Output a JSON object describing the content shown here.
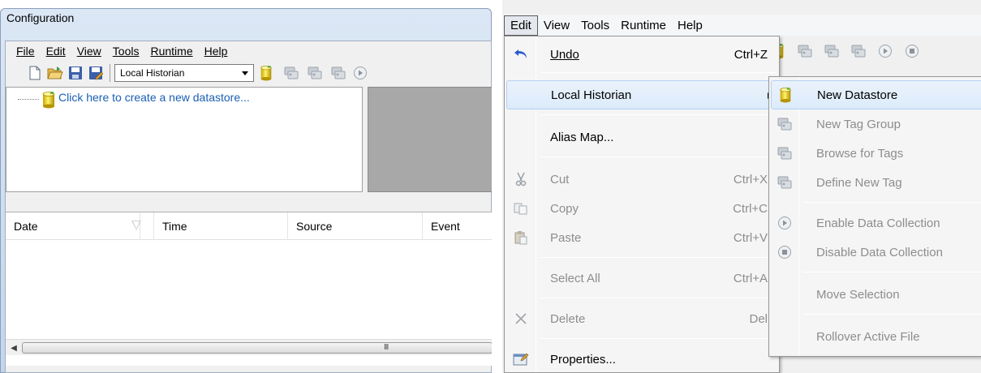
{
  "left_window": {
    "title": "Configuration",
    "menu": [
      "File",
      "Edit",
      "View",
      "Tools",
      "Runtime",
      "Help"
    ],
    "toolbar": {
      "datastore_select": "Local Historian",
      "icons": [
        "new-icon",
        "open-folder-icon",
        "save-icon",
        "save-as-icon",
        "datastore-icon",
        "tag-group-icon",
        "browse-tags-icon",
        "define-tag-icon",
        "play-icon"
      ]
    },
    "tree": {
      "create_link": "Click here to create a new datastore..."
    },
    "log_table": {
      "columns": [
        "Date",
        "Time",
        "Source",
        "Event"
      ],
      "rows": []
    },
    "scrollbar_grip": "III"
  },
  "right_window": {
    "menu": [
      "Edit",
      "View",
      "Tools",
      "Runtime",
      "Help"
    ],
    "active_menu": "Edit",
    "edit_menu": {
      "items": [
        {
          "label": "Undo",
          "shortcut": "Ctrl+Z",
          "enabled": true,
          "icon": "undo-icon"
        },
        {
          "label": "Local Historian",
          "shortcut": "",
          "enabled": true,
          "submenu": true,
          "highlighted": true
        },
        {
          "label": "Alias Map...",
          "shortcut": "",
          "enabled": true
        },
        {
          "label": "Cut",
          "shortcut": "Ctrl+X",
          "enabled": false,
          "icon": "scissors-icon"
        },
        {
          "label": "Copy",
          "shortcut": "Ctrl+C",
          "enabled": false,
          "icon": "copy-icon"
        },
        {
          "label": "Paste",
          "shortcut": "Ctrl+V",
          "enabled": false,
          "icon": "paste-icon"
        },
        {
          "label": "Select All",
          "shortcut": "Ctrl+A",
          "enabled": false
        },
        {
          "label": "Delete",
          "shortcut": "Del",
          "enabled": false,
          "icon": "delete-x-icon"
        },
        {
          "label": "Properties...",
          "shortcut": "",
          "enabled": true,
          "icon": "properties-icon"
        }
      ]
    },
    "submenu": {
      "items": [
        {
          "label": "New Datastore",
          "enabled": true,
          "highlighted": true,
          "icon": "datastore-icon"
        },
        {
          "label": "New Tag Group",
          "enabled": false,
          "icon": "tag-group-icon"
        },
        {
          "label": "Browse for Tags",
          "enabled": false,
          "icon": "browse-tags-icon"
        },
        {
          "label": "Define New Tag",
          "enabled": false,
          "icon": "define-tag-icon"
        },
        {
          "label": "Enable Data Collection",
          "enabled": false,
          "icon": "play-icon"
        },
        {
          "label": "Disable Data Collection",
          "enabled": false,
          "icon": "stop-icon"
        },
        {
          "label": "Move Selection",
          "enabled": false
        },
        {
          "label": "Rollover Active File",
          "enabled": false
        }
      ]
    }
  },
  "colors": {
    "link": "#1a5fb4",
    "menu_highlight": "#dcebfb",
    "disabled_text": "#8d8d8d",
    "datastore_yellow": "#e8c400"
  }
}
